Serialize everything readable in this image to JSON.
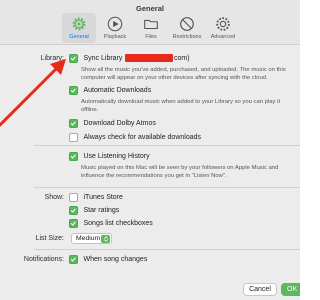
{
  "window": {
    "title": "General"
  },
  "toolbar": {
    "tabs": [
      {
        "label": "General",
        "icon": "gear-icon",
        "selected": true
      },
      {
        "label": "Playback",
        "icon": "play-icon",
        "selected": false
      },
      {
        "label": "Files",
        "icon": "folder-icon",
        "selected": false
      },
      {
        "label": "Restrictions",
        "icon": "restrictions-icon",
        "selected": false
      },
      {
        "label": "Advanced",
        "icon": "advanced-gear-icon",
        "selected": false
      }
    ]
  },
  "library": {
    "label": "Library:",
    "sync_label": "Sync Library",
    "sync_suffix": "com)",
    "sync_desc": "Show all the music you've added, purchased, and uploaded. The music on this computer will appear on your other devices after syncing with the cloud.",
    "auto_downloads_label": "Automatic Downloads",
    "auto_downloads_desc": "Automatically download music when added to your Library so you can play it offline.",
    "dolby_label": "Download Dolby Atmos",
    "check_downloads_label": "Always check for available downloads",
    "listening_history_label": "Use Listening History",
    "listening_history_desc": "Music played on this Mac will be seen by your followers on Apple Music and influence the recommendations you get in \"Listen Now\"."
  },
  "show": {
    "label": "Show:",
    "itunes_store_label": "iTunes Store",
    "star_ratings_label": "Star ratings",
    "songs_checkboxes_label": "Songs list checkboxes"
  },
  "list_size": {
    "label": "List Size:",
    "value": "Medium"
  },
  "notifications": {
    "label": "Notifications:",
    "song_changes_label": "When song changes"
  },
  "buttons": {
    "cancel_label": "Cancel",
    "ok_label": "OK"
  },
  "colors": {
    "accent_green": "#5cb85c",
    "annotation_red": "#e8291c",
    "selected_tab": "#007aff"
  }
}
